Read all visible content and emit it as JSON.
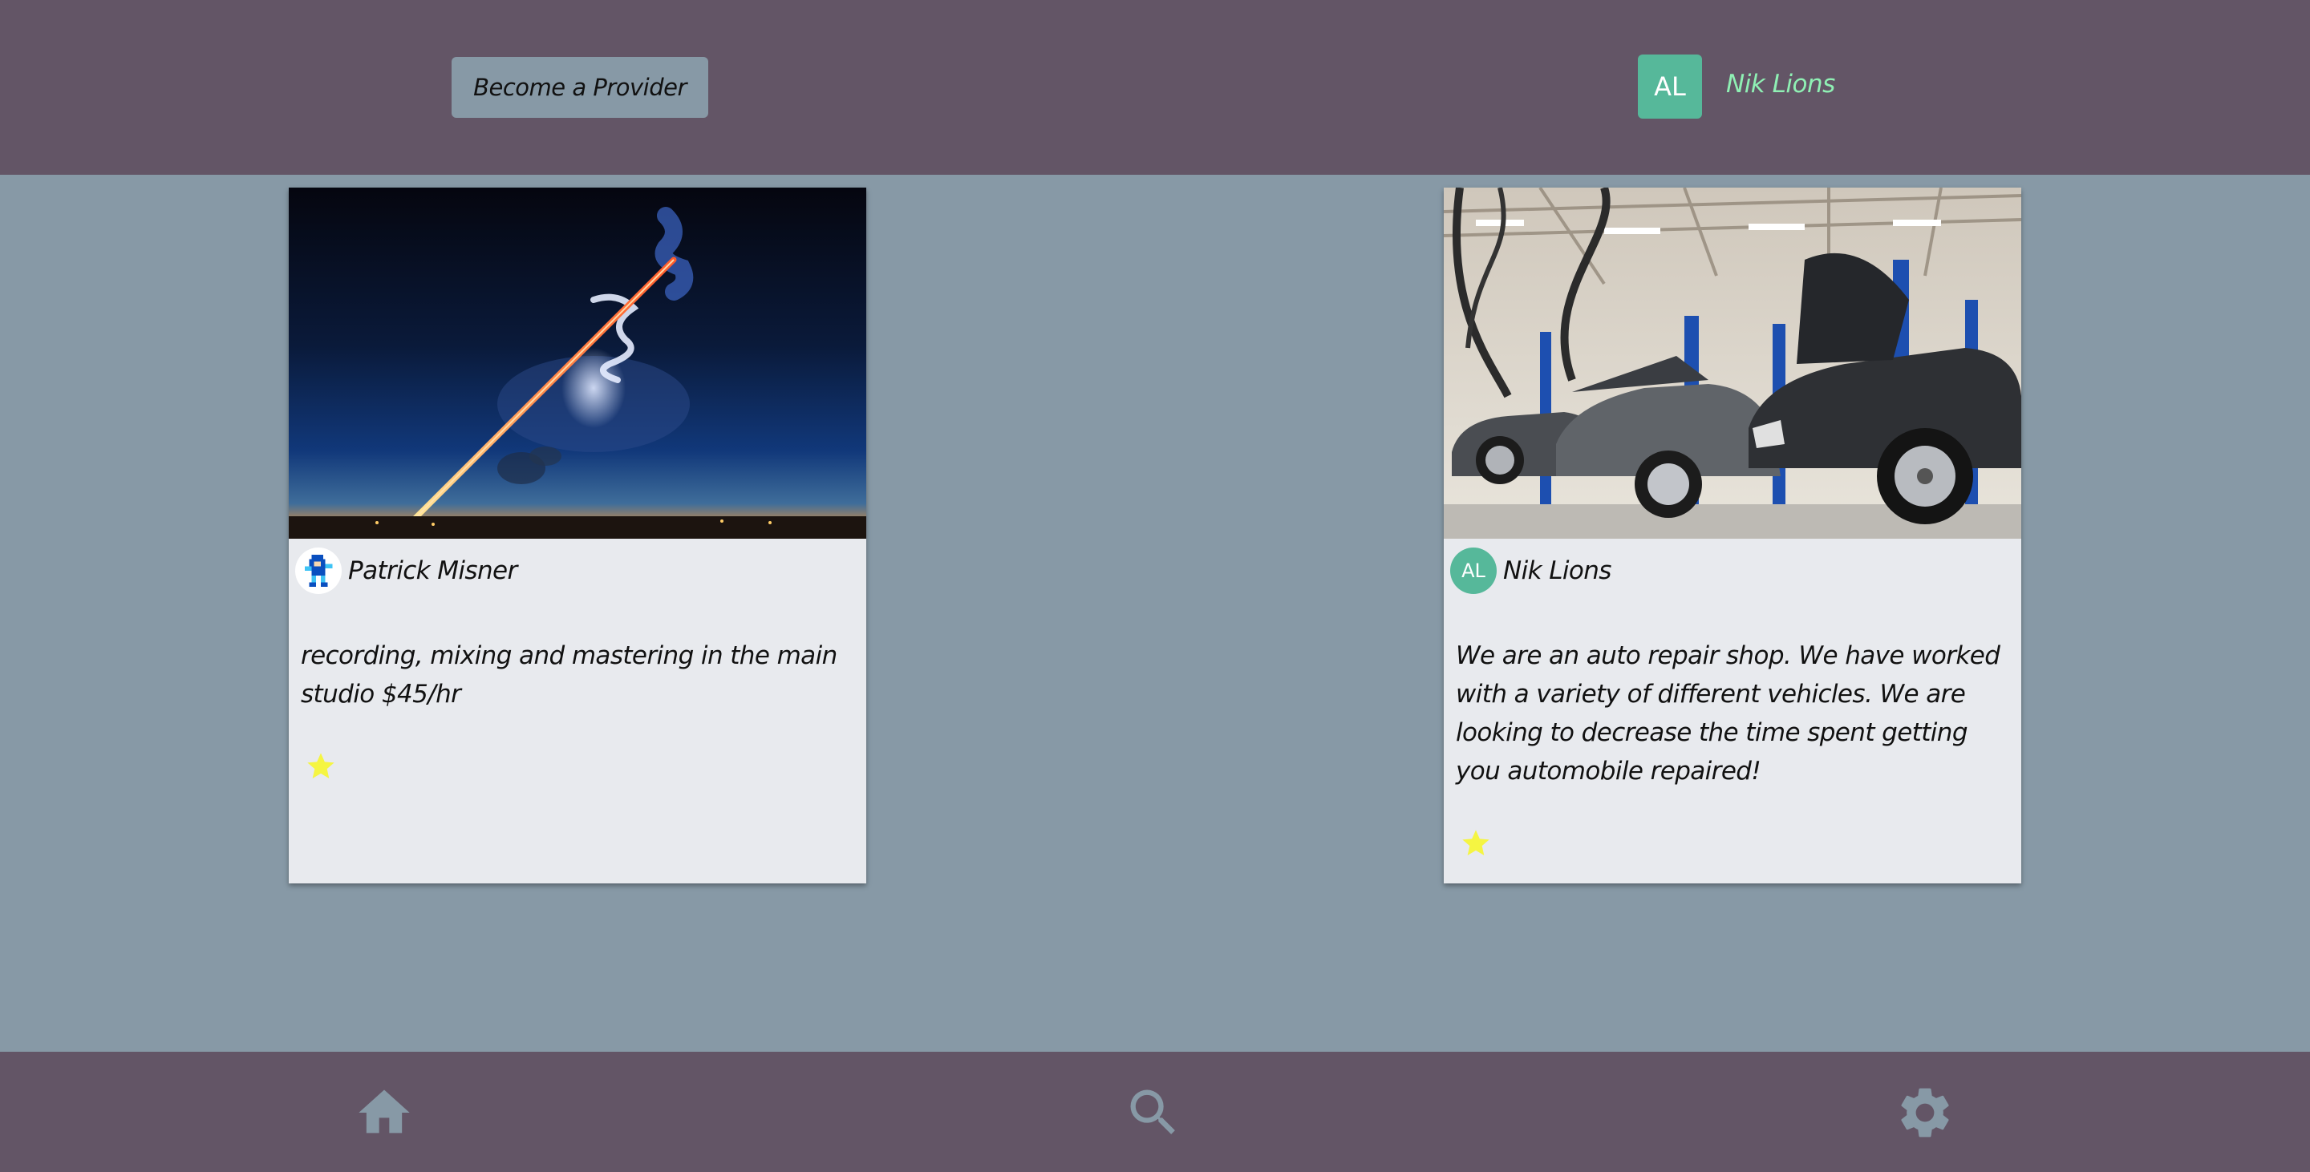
{
  "header": {
    "become_provider_label": "Become a Provider",
    "user": {
      "initials": "AL",
      "name": "Nik Lions"
    }
  },
  "cards": [
    {
      "image": "rocket-launch-night-sky",
      "author": {
        "name": "Patrick Misner",
        "avatar": "pixel-character-avatar"
      },
      "description": "recording, mixing and mastering in the main studio $45/hr",
      "rating_stars": 1
    },
    {
      "image": "auto-repair-garage-cars-on-lifts",
      "author": {
        "name": "Nik Lions",
        "initials": "AL"
      },
      "description": "We are an auto repair shop. We have worked with a variety of different vehicles. We are looking to decrease the time spent getting you automobile repaired!",
      "rating_stars": 1
    }
  ],
  "footer": {
    "icons": [
      "home-icon",
      "search-icon",
      "settings-icon"
    ]
  },
  "colors": {
    "header_bg": "#635566",
    "page_bg": "#8799a6",
    "card_bg": "#e8eaee",
    "accent_green": "#56b89a",
    "user_name": "#8ff0b4",
    "star": "#f5f542",
    "nav_icon": "#8799a6"
  }
}
